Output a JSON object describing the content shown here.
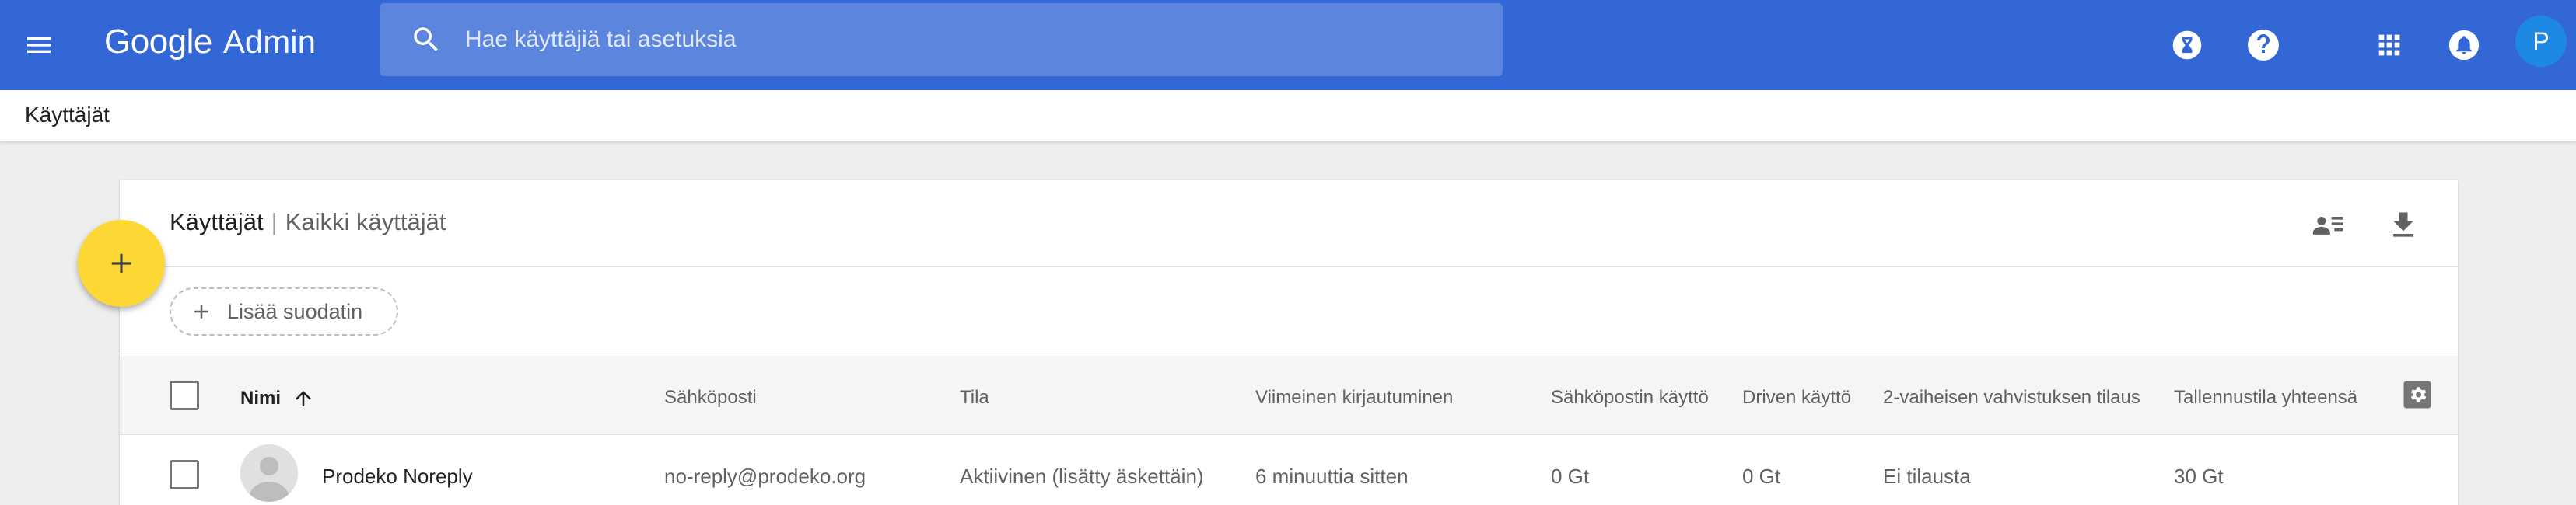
{
  "app": {
    "brand": "Google",
    "product": "Admin"
  },
  "search": {
    "placeholder": "Hae käyttäjiä tai asetuksia"
  },
  "account": {
    "avatar_letter": "P"
  },
  "breadcrumb": {
    "current": "Käyttäjät"
  },
  "card": {
    "title": "Käyttäjät",
    "separator": "|",
    "subtitle": "Kaikki käyttäjät"
  },
  "filter": {
    "add_label": "Lisää suodatin"
  },
  "table": {
    "columns": [
      "Nimi",
      "Sähköposti",
      "Tila",
      "Viimeinen kirjautuminen",
      "Sähköpostin käyttö",
      "Driven käyttö",
      "2-vaiheisen vahvistuksen tilaus",
      "Tallennustila yhteensä"
    ],
    "sort_column": "Nimi",
    "sort_direction": "ascending",
    "rows": [
      {
        "name": "Prodeko Noreply",
        "email": "no-reply@prodeko.org",
        "status": "Aktiivinen (lisätty äskettäin)",
        "last_login": "6 minuuttia sitten",
        "email_usage": "0 Gt",
        "drive_usage": "0 Gt",
        "two_step": "Ei tilausta",
        "storage_total": "30 Gt"
      }
    ]
  },
  "colors": {
    "topbar": "#3367d6",
    "search_bg": "#5c85de",
    "fab": "#fdd835",
    "avatar": "#1e88e5"
  },
  "icons": {
    "menu": "hamburger-menu-icon",
    "search": "search-icon",
    "hourglass": "hourglass-icon",
    "help": "help-icon",
    "apps": "apps-grid-icon",
    "notifications": "notifications-bell-icon",
    "user_list": "manage-columns-person-list-icon",
    "download": "download-icon",
    "add": "plus-icon",
    "sort": "arrow-up-icon",
    "settings": "gear-icon"
  }
}
